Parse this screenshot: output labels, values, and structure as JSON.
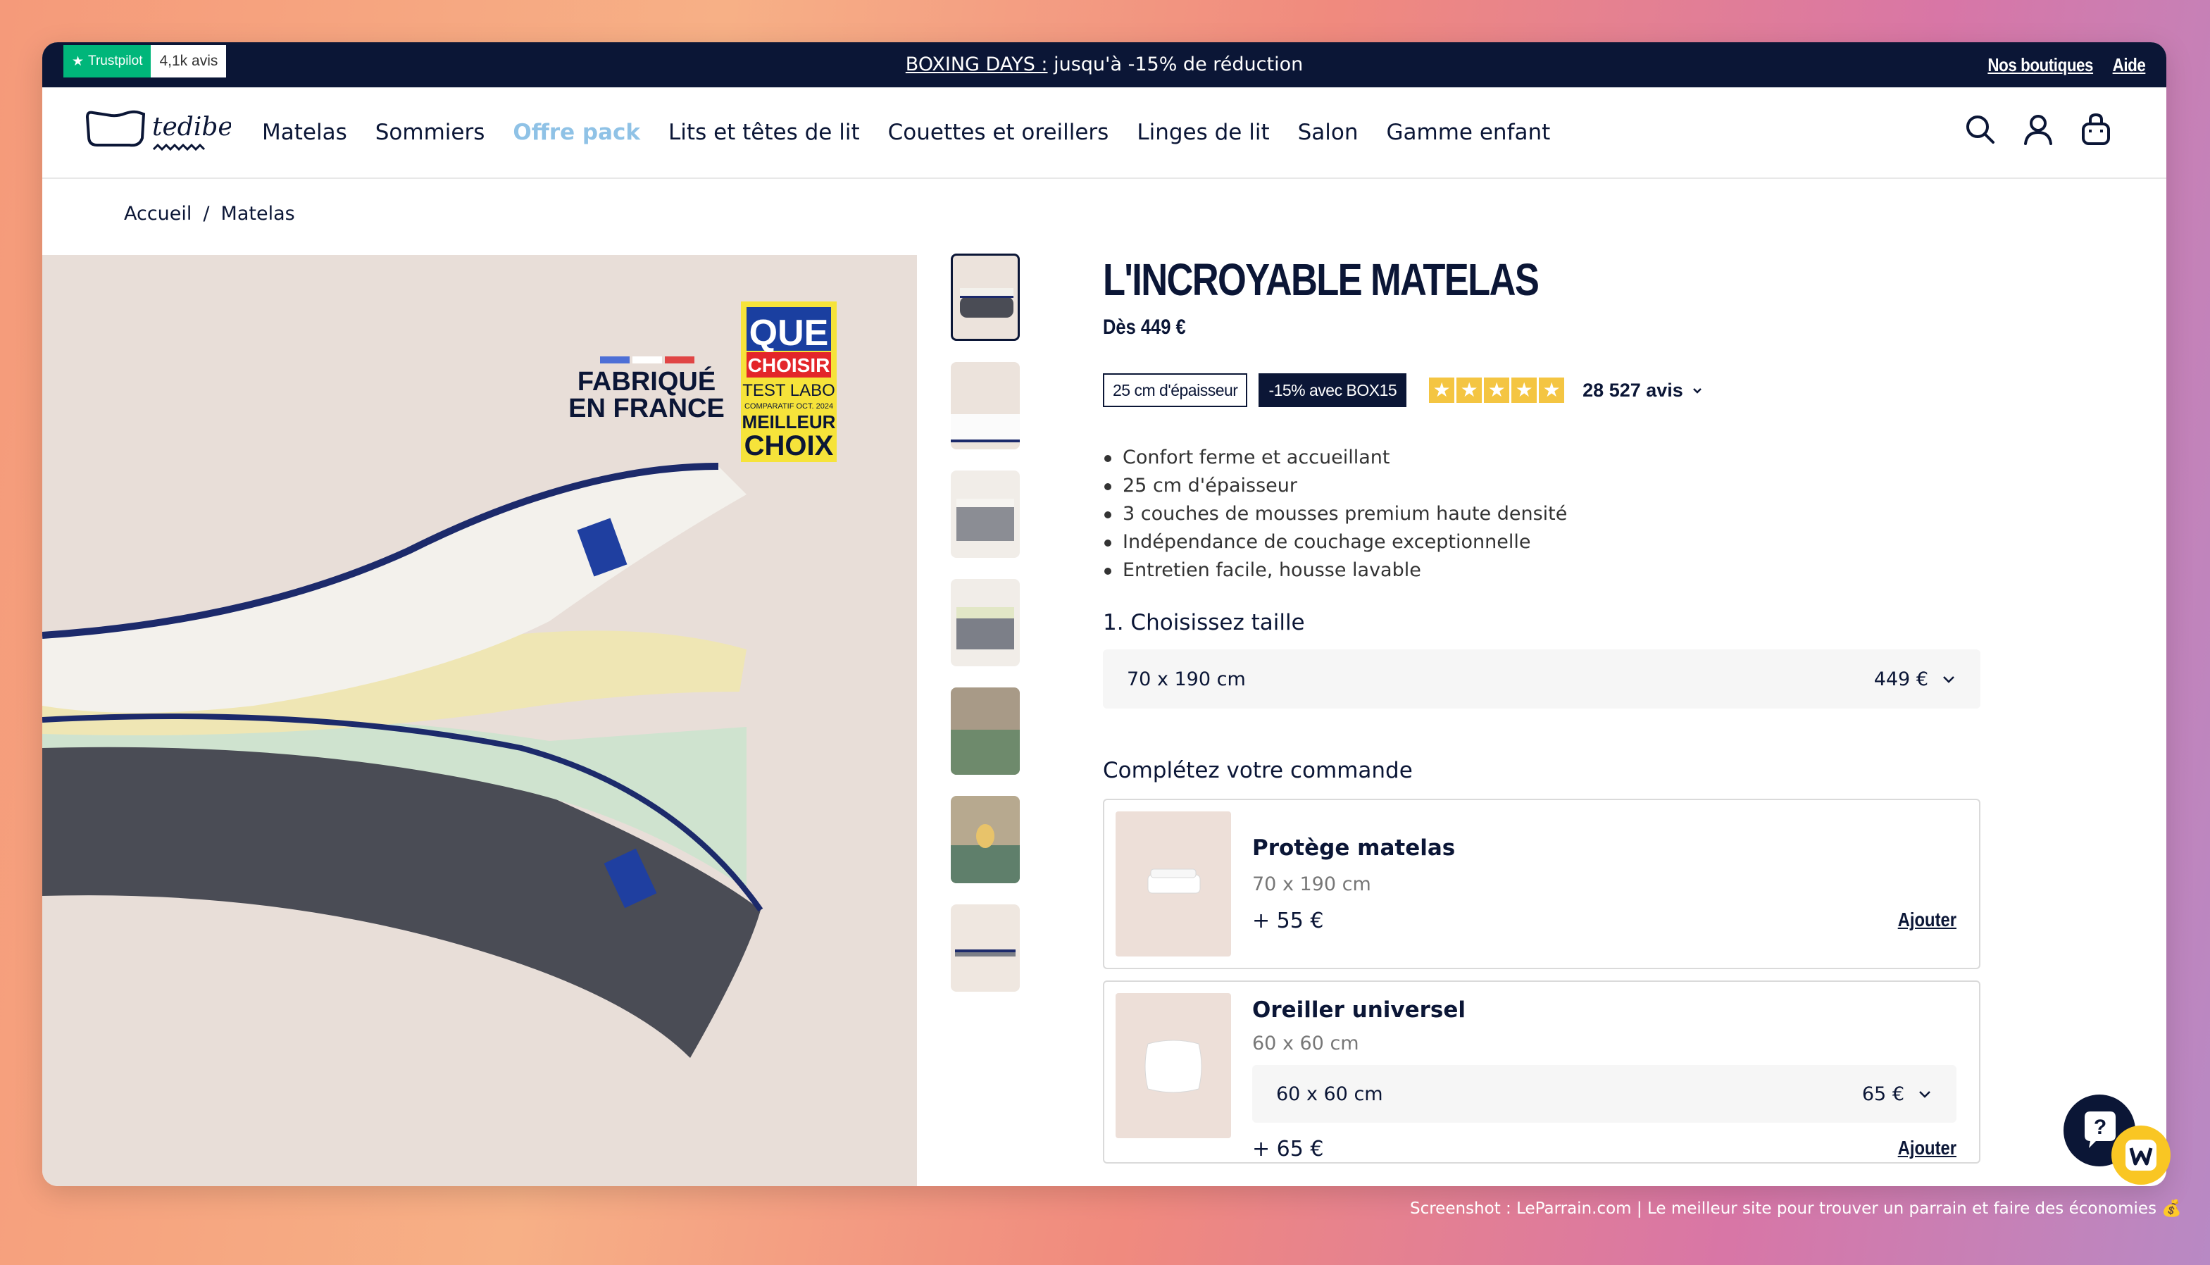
{
  "topbar": {
    "trustpilot_label": "Trustpilot",
    "trustpilot_count": "4,1k avis",
    "promo_highlight": "BOXING DAYS :",
    "promo_text": " jusqu'à -15% de réduction",
    "links": [
      "Nos boutiques",
      "Aide"
    ]
  },
  "nav": {
    "logo_text": "tediber.",
    "items": [
      "Matelas",
      "Sommiers",
      "Offre pack",
      "Lits et têtes de lit",
      "Couettes et oreillers",
      "Linges de lit",
      "Salon",
      "Gamme enfant"
    ],
    "highlight_color": "#8fc2e6",
    "icons": [
      "search-icon",
      "account-icon",
      "cart-icon"
    ]
  },
  "breadcrumb": {
    "items": [
      "Accueil",
      "Matelas"
    ],
    "separator": "/"
  },
  "hero": {
    "flag_text_1": "FABRIQUÉ",
    "flag_text_2": "EN FRANCE",
    "award_1": "QUE",
    "award_2": "CHOISIR",
    "award_3": "TEST LABO",
    "award_4": "COMPARATIF OCT. 2024",
    "award_5": "MEILLEUR",
    "award_6": "CHOIX"
  },
  "product": {
    "title": "L'INCROYABLE MATELAS",
    "price": "Dès 449 €",
    "badge_thickness": "25 cm d'épaisseur",
    "badge_promo": "-15% avec BOX15",
    "stars": 5,
    "reviews": "28 527 avis",
    "bullets": [
      "Confort ferme et accueillant",
      "25 cm d'épaisseur",
      "3 couches de mousses premium haute densité",
      "Indépendance de couchage exceptionnelle",
      "Entretien facile, housse lavable"
    ],
    "size_label": "1. Choisissez taille",
    "size_value": "70 x 190 cm",
    "size_price": "449 €"
  },
  "complete": {
    "label": "Complétez votre commande",
    "items": [
      {
        "name": "Protège matelas",
        "size": "70 x 190 cm",
        "price": "+ 55 €",
        "action": "Ajouter"
      },
      {
        "name": "Oreiller universel",
        "size": "60 x 60 cm",
        "select_value": "60 x 60 cm",
        "select_price": "65 €",
        "price": "+ 65 €",
        "action": "Ajouter"
      }
    ]
  },
  "watermark": "Screenshot : LeParrain.com | Le meilleur site pour trouver un parrain et faire des économies 💰",
  "colors": {
    "navy": "#0b1636",
    "trustpilot": "#00b67a",
    "star": "#f4c542",
    "hero_bg": "#e8ded8"
  }
}
